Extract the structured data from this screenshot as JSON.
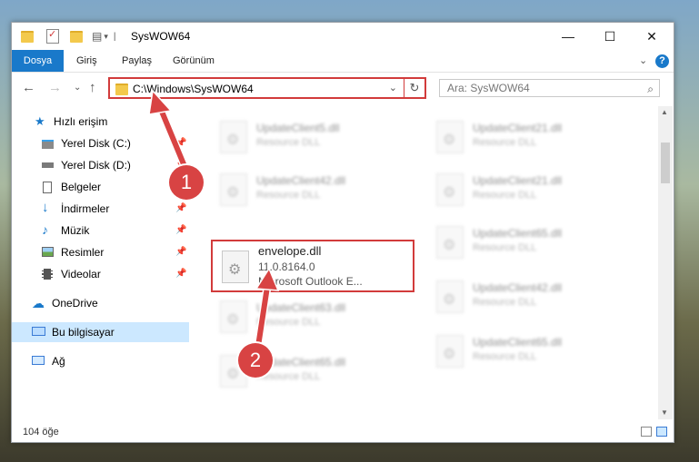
{
  "window": {
    "title": "SysWOW64",
    "minimize_glyph": "—",
    "maximize_glyph": "☐",
    "close_glyph": "✕"
  },
  "ribbon": {
    "tabs": [
      "Dosya",
      "Giriş",
      "Paylaş",
      "Görünüm"
    ],
    "expand_glyph": "⌄",
    "help_glyph": "?"
  },
  "address": {
    "path": "C:\\Windows\\SysWOW64",
    "chevron_glyph": "⌄",
    "refresh_glyph": "↻",
    "search_placeholder": "Ara: SysWOW64",
    "search_glyph": "⌕"
  },
  "nav_buttons": {
    "back": "←",
    "forward": "→",
    "recent": "⌄",
    "up": "↑"
  },
  "sidebar": {
    "items": [
      {
        "label": "Hızlı erişim",
        "icon": "star-icon"
      },
      {
        "label": "Yerel Disk (C:)",
        "icon": "disk-icon"
      },
      {
        "label": "Yerel Disk (D:)",
        "icon": "disk-icon"
      },
      {
        "label": "Belgeler",
        "icon": "documents-icon"
      },
      {
        "label": "İndirmeler",
        "icon": "download-icon"
      },
      {
        "label": "Müzik",
        "icon": "music-icon"
      },
      {
        "label": "Resimler",
        "icon": "pictures-icon"
      },
      {
        "label": "Videolar",
        "icon": "videos-icon"
      },
      {
        "label": "OneDrive",
        "icon": "cloud-icon"
      },
      {
        "label": "Bu bilgisayar",
        "icon": "computer-icon"
      },
      {
        "label": "Ağ",
        "icon": "network-icon"
      }
    ],
    "pin_glyph": "📌"
  },
  "files": {
    "left": [
      {
        "name": "UpdateClient5.dll",
        "type": "Resource DLL"
      },
      {
        "name": "UpdateClient42.dll",
        "type": "Resource DLL"
      },
      {
        "name": "envelope.dll",
        "type": "11.0.8164.0",
        "desc": "Microsoft Outlook E..."
      },
      {
        "name": "UpdateClient63.dll",
        "type": "Resource DLL"
      },
      {
        "name": "UpdateClient65.dll",
        "type": "Resource DLL"
      }
    ],
    "right": [
      {
        "name": "UpdateClient21.dll",
        "type": "Resource DLL"
      },
      {
        "name": "UpdateClient21.dll",
        "type": "Resource DLL"
      },
      {
        "name": "UpdateClient65.dll",
        "type": "Resource DLL"
      },
      {
        "name": "UpdateClient42.dll",
        "type": "Resource DLL"
      },
      {
        "name": "UpdateClient65.dll",
        "type": "Resource DLL"
      }
    ]
  },
  "status": {
    "count": "104 öğe"
  },
  "callouts": [
    "1",
    "2"
  ],
  "colors": {
    "accent": "#1979ca",
    "highlight": "#d23b3b",
    "callout": "#d84343",
    "selected_nav": "#cce8ff"
  }
}
